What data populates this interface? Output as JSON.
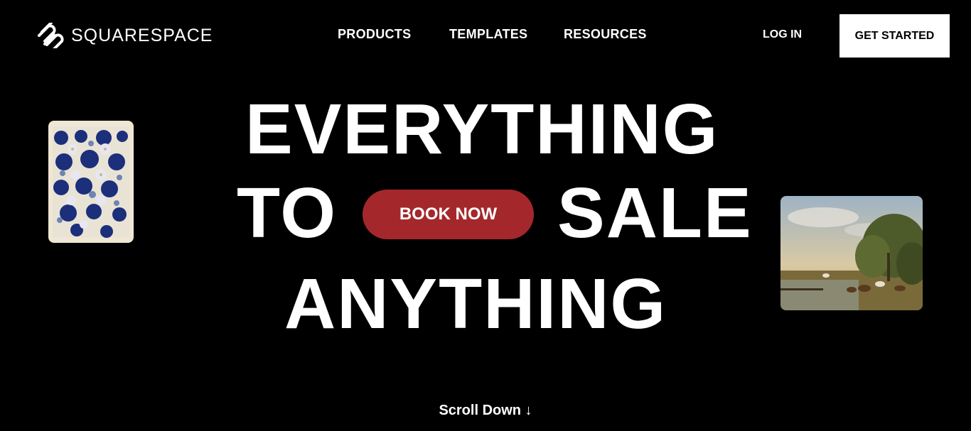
{
  "header": {
    "logo_text": "SQUARESPACE",
    "nav": [
      "PRODUCTS",
      "TEMPLATES",
      "RESOURCES"
    ],
    "login_label": "LOG IN",
    "cta_label": "GET STARTED"
  },
  "hero": {
    "line1": "EVERYTHING",
    "line2_left": "TO",
    "button_label": "BOOK NOW",
    "line2_right": "SALE",
    "line3": "ANYTHING"
  },
  "scroll_label": "Scroll Down ↓",
  "colors": {
    "background": "#000000",
    "text": "#ffffff",
    "book_button": "#a4282b",
    "cta_background": "#ffffff"
  }
}
